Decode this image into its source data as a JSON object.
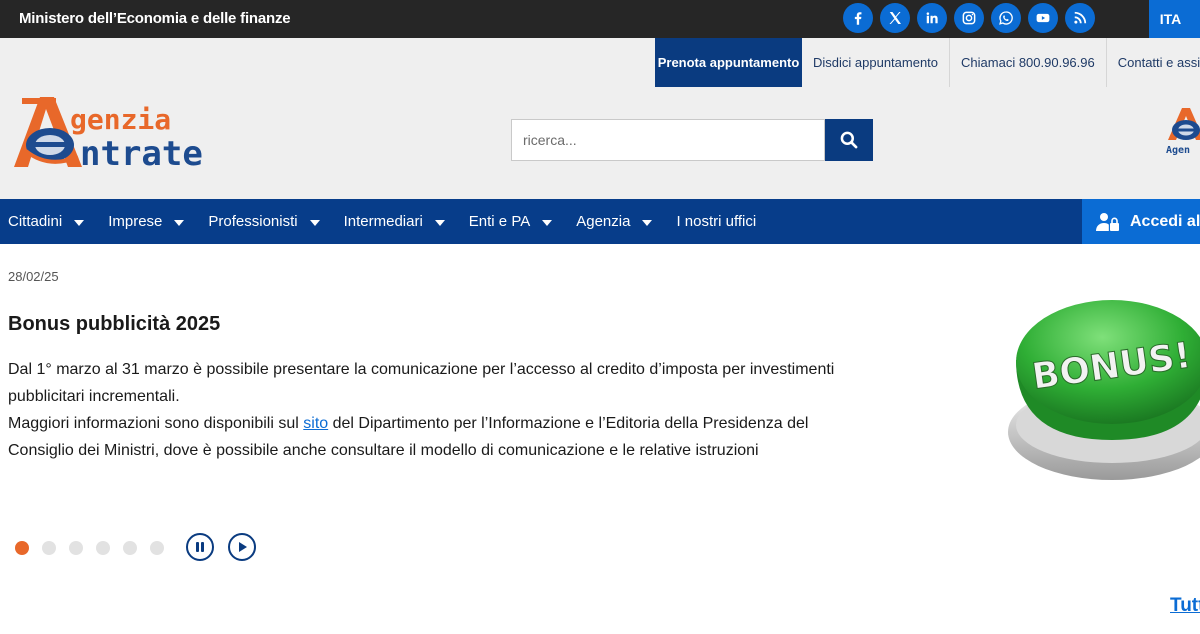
{
  "topbar": {
    "ministry": "Ministero dell’Economia e delle finanze",
    "socials": [
      "facebook-icon",
      "x-icon",
      "linkedin-icon",
      "instagram-icon",
      "whatsapp-icon",
      "youtube-icon",
      "rss-icon"
    ],
    "language": "ITA"
  },
  "header": {
    "utility": [
      "Prenota appuntamento",
      "Disdici appuntamento",
      "Chiamaci 800.90.96.96",
      "Contatti e assistenza"
    ],
    "logo": {
      "line1": "genzia",
      "line2": "ntrate"
    },
    "search_placeholder": "ricerca...",
    "mini_logo_text": "Agen"
  },
  "nav": {
    "items": [
      "Cittadini",
      "Imprese",
      "Professionisti",
      "Intermediari",
      "Enti e PA",
      "Agenzia",
      "I nostri uffici"
    ],
    "access": "Accedi all'"
  },
  "slide": {
    "date": "28/02/25",
    "title": "Bonus pubblicità 2025",
    "p1": "Dal 1° marzo al 31 marzo è possibile presentare la comunicazione per l’accesso al credito d’imposta per investimenti pubblicitari incrementali.",
    "p2_before": "Maggiori informazioni sono disponibili sul ",
    "p2_link": "sito",
    "p2_after": " del Dipartimento per l’Informazione e l’Editoria della Presidenza del Consiglio dei Ministri, dove è possibile anche consultare il modello di comunicazione e le relative istruzioni",
    "image_text": "BONUS!"
  },
  "carousel": {
    "total": 6,
    "current": 1
  },
  "footer_link": "Tutt",
  "colors": {
    "dark": "#262626",
    "navy": "#073d8a",
    "blue": "#0b6cd4",
    "orange": "#e8682a"
  }
}
